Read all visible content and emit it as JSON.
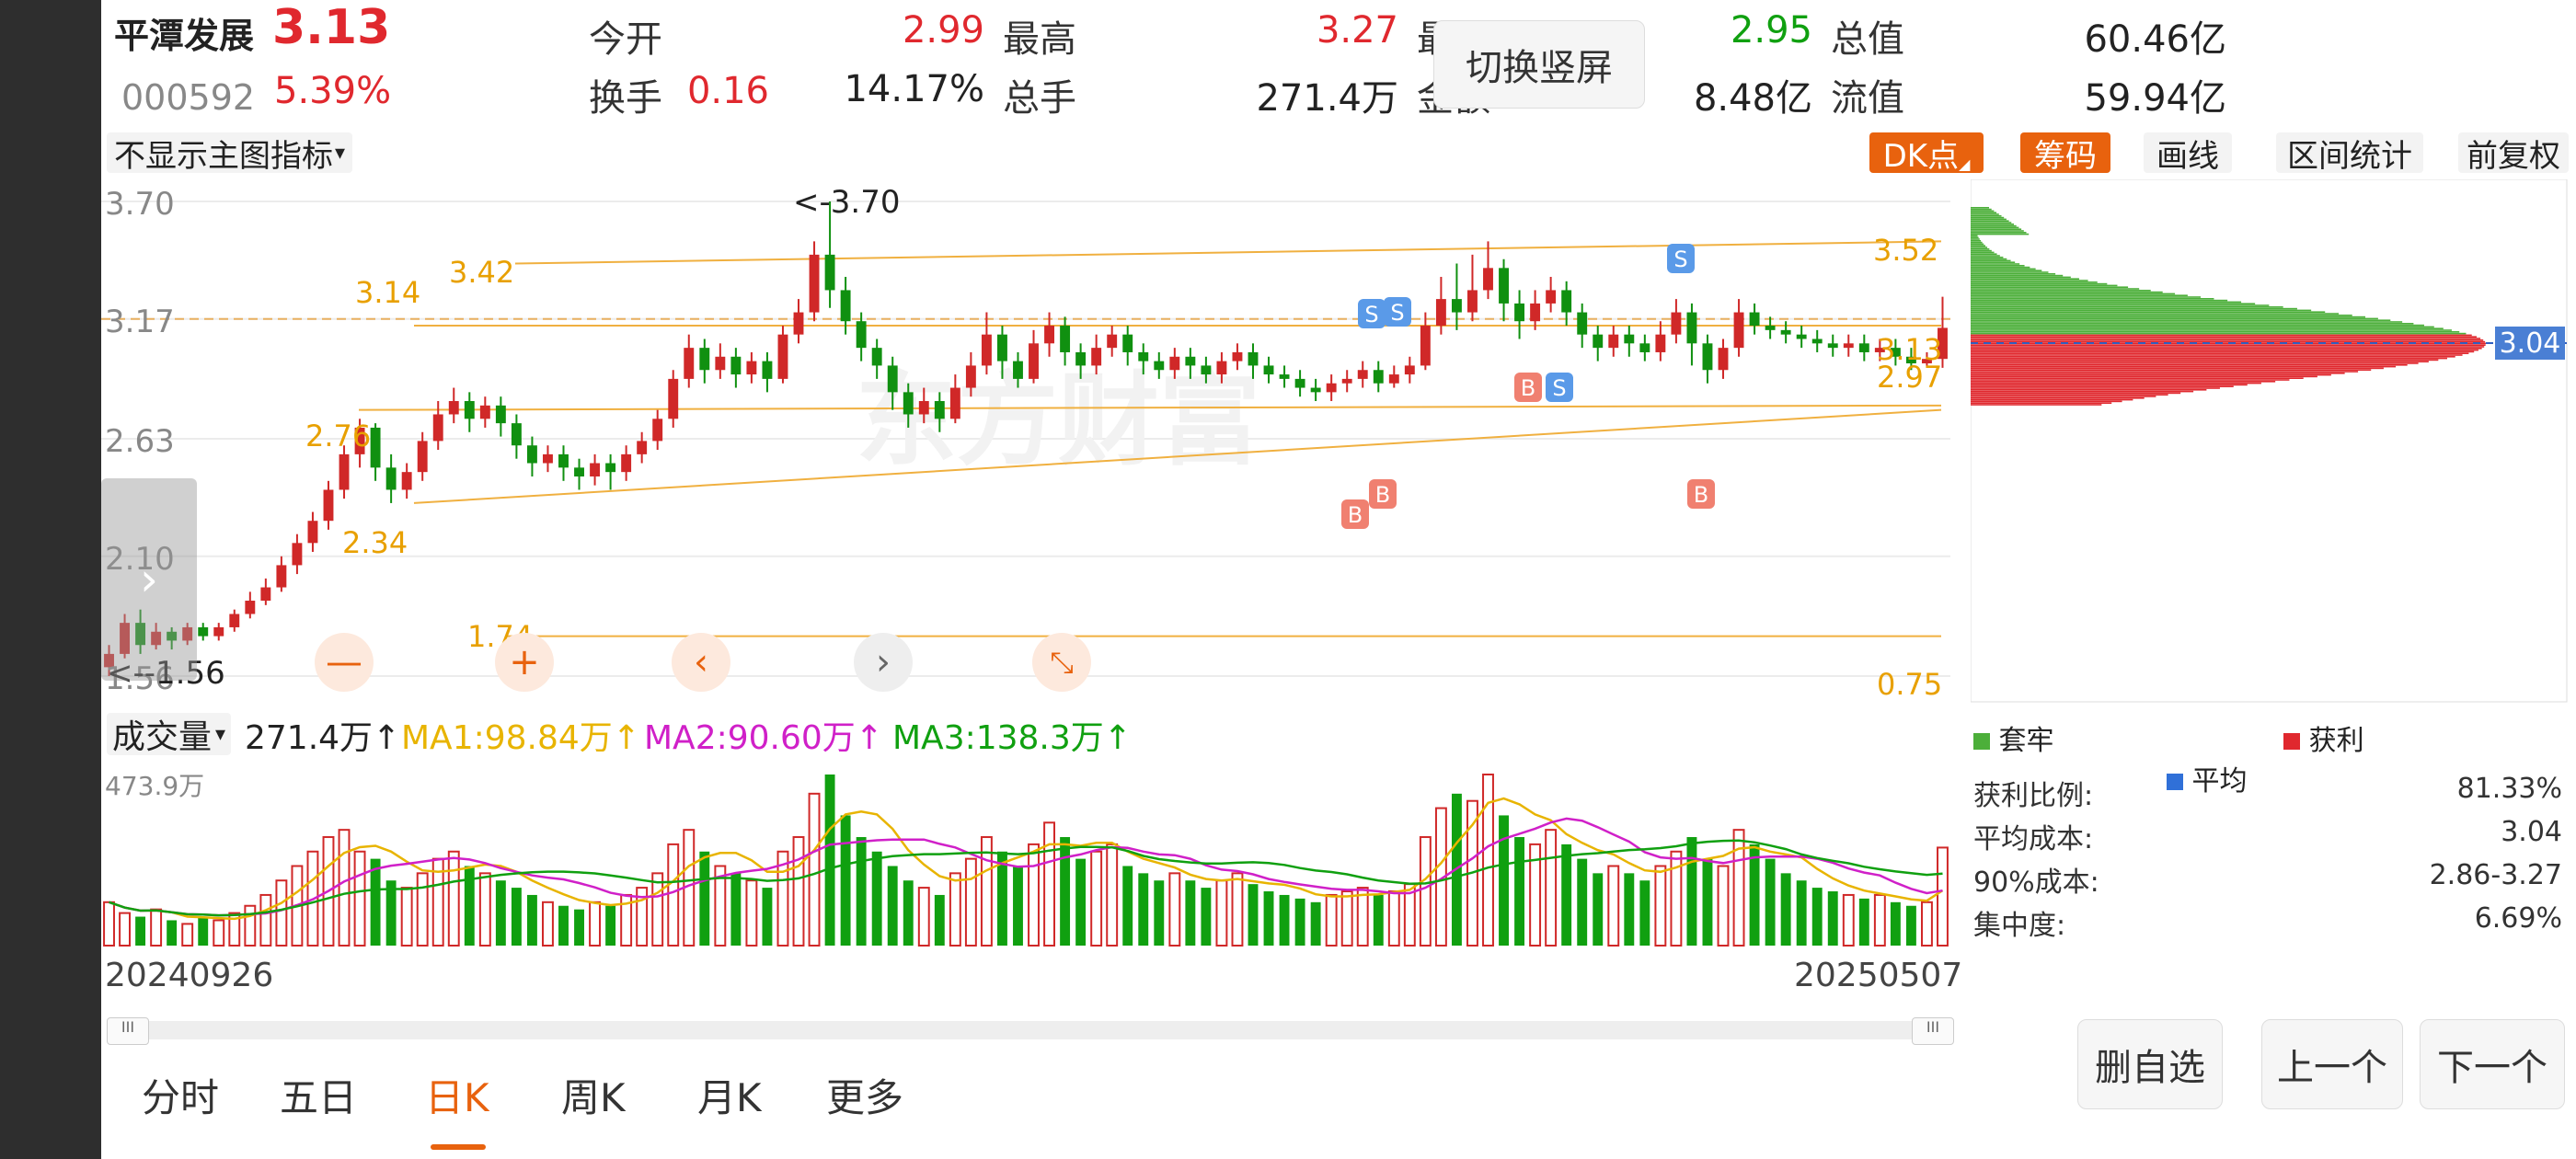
{
  "stock": {
    "name": "平潭发展",
    "price": "3.13",
    "code": "000592",
    "change_pct": "5.39%",
    "change": "0.16"
  },
  "quotes": [
    {
      "label": "今开",
      "value": "2.99",
      "color": "red"
    },
    {
      "label": "最高",
      "value": "3.27",
      "color": "red"
    },
    {
      "label": "最低",
      "value": "2.95",
      "color": "green"
    },
    {
      "label": "总值",
      "value": "60.46亿",
      "color": "black"
    },
    {
      "label": "换手",
      "value": "14.17%",
      "color": "black"
    },
    {
      "label": "总手",
      "value": "271.4万",
      "color": "black"
    },
    {
      "label": "金额",
      "value": "8.48亿",
      "color": "black"
    },
    {
      "label": "流值",
      "value": "59.94亿",
      "color": "black"
    }
  ],
  "switch_button": "切换竖屏",
  "toolbar": {
    "indicator_select": "不显示主图指标",
    "dk": "DK点",
    "chips": "筹码",
    "draw": "画线",
    "interval": "区间统计",
    "adjust": "前复权"
  },
  "price_axis": [
    "3.70",
    "3.17",
    "2.63",
    "2.10",
    "1.56"
  ],
  "price_annotations": {
    "high_marker": "<-3.70",
    "low_marker": "<--1.56",
    "level_342": "3.42",
    "level_314": "3.14",
    "level_352": "3.52",
    "level_276": "2.76",
    "level_234": "2.34",
    "level_174": "1.74",
    "level_313": "3.13",
    "level_297": "2.97",
    "level_075": "0.75"
  },
  "chip_price": "3.04",
  "chip_legend": {
    "trapped": "套牢",
    "profit": "获利",
    "average": "平均"
  },
  "chip_stats": [
    {
      "label": "获利比例:",
      "value": "81.33%"
    },
    {
      "label": "平均成本:",
      "value": "3.04"
    },
    {
      "label": "90%成本:",
      "value": "2.86-3.27"
    },
    {
      "label": "集中度:",
      "value": "6.69%"
    }
  ],
  "volume": {
    "selector": "成交量",
    "current": "271.4万↑",
    "ma1": "MA1:98.84万↑",
    "ma2": "MA2:90.60万↑",
    "ma3": "MA3:138.3万↑",
    "axis_top": "473.9万"
  },
  "dates": {
    "start": "20240926",
    "end": "20250507"
  },
  "watermark": "东方财富",
  "period_tabs": [
    "分时",
    "五日",
    "日K",
    "周K",
    "月K",
    "更多"
  ],
  "active_tab": "日K",
  "bottom_buttons": {
    "delete": "删自选",
    "prev": "上一个",
    "next": "下一个"
  },
  "colors": {
    "up": "#e0282e",
    "down": "#10a010",
    "accent": "#e8620e",
    "ma1": "#e8b400",
    "ma2": "#d020c8",
    "ma3": "#10a010"
  },
  "chart_data": {
    "type": "candlestick",
    "ylim": [
      1.56,
      3.7
    ],
    "candles": [
      [
        1.6,
        1.66,
        1.56,
        1.7
      ],
      [
        1.66,
        1.8,
        1.64,
        1.84
      ],
      [
        1.8,
        1.7,
        1.66,
        1.86
      ],
      [
        1.7,
        1.76,
        1.68,
        1.8
      ],
      [
        1.76,
        1.72,
        1.68,
        1.78
      ],
      [
        1.72,
        1.78,
        1.7,
        1.8
      ],
      [
        1.78,
        1.74,
        1.72,
        1.8
      ],
      [
        1.74,
        1.78,
        1.72,
        1.8
      ],
      [
        1.78,
        1.84,
        1.76,
        1.86
      ],
      [
        1.84,
        1.9,
        1.82,
        1.94
      ],
      [
        1.9,
        1.96,
        1.88,
        2.0
      ],
      [
        1.96,
        2.06,
        1.94,
        2.1
      ],
      [
        2.06,
        2.16,
        2.02,
        2.2
      ],
      [
        2.16,
        2.26,
        2.12,
        2.3
      ],
      [
        2.26,
        2.4,
        2.22,
        2.44
      ],
      [
        2.4,
        2.56,
        2.36,
        2.6
      ],
      [
        2.56,
        2.68,
        2.5,
        2.72
      ],
      [
        2.68,
        2.5,
        2.44,
        2.7
      ],
      [
        2.5,
        2.4,
        2.34,
        2.56
      ],
      [
        2.4,
        2.48,
        2.36,
        2.52
      ],
      [
        2.48,
        2.62,
        2.44,
        2.66
      ],
      [
        2.62,
        2.74,
        2.58,
        2.8
      ],
      [
        2.74,
        2.8,
        2.7,
        2.86
      ],
      [
        2.8,
        2.72,
        2.66,
        2.84
      ],
      [
        2.72,
        2.78,
        2.68,
        2.82
      ],
      [
        2.78,
        2.7,
        2.64,
        2.82
      ],
      [
        2.7,
        2.6,
        2.54,
        2.74
      ],
      [
        2.6,
        2.52,
        2.46,
        2.64
      ],
      [
        2.52,
        2.56,
        2.48,
        2.6
      ],
      [
        2.56,
        2.5,
        2.44,
        2.6
      ],
      [
        2.5,
        2.46,
        2.4,
        2.54
      ],
      [
        2.46,
        2.52,
        2.42,
        2.56
      ],
      [
        2.52,
        2.48,
        2.4,
        2.56
      ],
      [
        2.48,
        2.56,
        2.44,
        2.6
      ],
      [
        2.56,
        2.62,
        2.52,
        2.66
      ],
      [
        2.62,
        2.72,
        2.58,
        2.76
      ],
      [
        2.72,
        2.9,
        2.68,
        2.94
      ],
      [
        2.9,
        3.04,
        2.86,
        3.1
      ],
      [
        3.04,
        2.94,
        2.88,
        3.08
      ],
      [
        2.94,
        3.0,
        2.9,
        3.06
      ],
      [
        3.0,
        2.92,
        2.86,
        3.04
      ],
      [
        2.92,
        2.98,
        2.88,
        3.02
      ],
      [
        2.98,
        2.9,
        2.84,
        3.02
      ],
      [
        2.9,
        3.1,
        2.88,
        3.14
      ],
      [
        3.1,
        3.2,
        3.06,
        3.26
      ],
      [
        3.2,
        3.46,
        3.16,
        3.52
      ],
      [
        3.46,
        3.3,
        3.22,
        3.7
      ],
      [
        3.3,
        3.16,
        3.1,
        3.36
      ],
      [
        3.16,
        3.04,
        2.98,
        3.2
      ],
      [
        3.04,
        2.96,
        2.9,
        3.08
      ],
      [
        2.96,
        2.84,
        2.76,
        3.0
      ],
      [
        2.84,
        2.74,
        2.68,
        2.88
      ],
      [
        2.74,
        2.8,
        2.7,
        2.86
      ],
      [
        2.8,
        2.72,
        2.66,
        2.84
      ],
      [
        2.72,
        2.86,
        2.7,
        2.92
      ],
      [
        2.86,
        2.96,
        2.82,
        3.02
      ],
      [
        2.96,
        3.1,
        2.92,
        3.2
      ],
      [
        3.1,
        2.98,
        2.9,
        3.14
      ],
      [
        2.98,
        2.9,
        2.86,
        3.02
      ],
      [
        2.9,
        3.06,
        2.88,
        3.12
      ],
      [
        3.06,
        3.14,
        3.0,
        3.2
      ],
      [
        3.14,
        3.02,
        2.96,
        3.18
      ],
      [
        3.02,
        2.96,
        2.9,
        3.06
      ],
      [
        2.96,
        3.04,
        2.92,
        3.1
      ],
      [
        3.04,
        3.1,
        3.0,
        3.14
      ],
      [
        3.1,
        3.02,
        2.96,
        3.14
      ],
      [
        3.02,
        2.98,
        2.92,
        3.06
      ],
      [
        2.98,
        2.94,
        2.9,
        3.02
      ],
      [
        2.94,
        3.0,
        2.9,
        3.04
      ],
      [
        3.0,
        2.96,
        2.9,
        3.04
      ],
      [
        2.96,
        2.92,
        2.88,
        3.0
      ],
      [
        2.92,
        2.98,
        2.88,
        3.02
      ],
      [
        2.98,
        3.02,
        2.94,
        3.06
      ],
      [
        3.02,
        2.96,
        2.9,
        3.06
      ],
      [
        2.96,
        2.92,
        2.88,
        3.0
      ],
      [
        2.92,
        2.9,
        2.86,
        2.96
      ],
      [
        2.9,
        2.86,
        2.82,
        2.94
      ],
      [
        2.86,
        2.84,
        2.8,
        2.9
      ],
      [
        2.84,
        2.88,
        2.8,
        2.92
      ],
      [
        2.88,
        2.9,
        2.84,
        2.94
      ],
      [
        2.9,
        2.94,
        2.86,
        2.98
      ],
      [
        2.94,
        2.88,
        2.84,
        2.98
      ],
      [
        2.88,
        2.92,
        2.86,
        2.96
      ],
      [
        2.92,
        2.96,
        2.88,
        3.0
      ],
      [
        2.96,
        3.14,
        2.94,
        3.2
      ],
      [
        3.14,
        3.26,
        3.1,
        3.36
      ],
      [
        3.26,
        3.2,
        3.12,
        3.42
      ],
      [
        3.2,
        3.3,
        3.16,
        3.46
      ],
      [
        3.3,
        3.4,
        3.26,
        3.52
      ],
      [
        3.4,
        3.24,
        3.16,
        3.44
      ],
      [
        3.24,
        3.16,
        3.08,
        3.3
      ],
      [
        3.16,
        3.24,
        3.12,
        3.3
      ],
      [
        3.24,
        3.3,
        3.2,
        3.36
      ],
      [
        3.3,
        3.2,
        3.14,
        3.34
      ],
      [
        3.2,
        3.1,
        3.04,
        3.24
      ],
      [
        3.1,
        3.04,
        2.98,
        3.14
      ],
      [
        3.04,
        3.1,
        3.0,
        3.14
      ],
      [
        3.1,
        3.06,
        3.0,
        3.14
      ],
      [
        3.06,
        3.02,
        2.98,
        3.1
      ],
      [
        3.02,
        3.1,
        2.98,
        3.16
      ],
      [
        3.1,
        3.2,
        3.06,
        3.26
      ],
      [
        3.2,
        3.06,
        2.96,
        3.24
      ],
      [
        3.06,
        2.94,
        2.88,
        3.1
      ],
      [
        2.94,
        3.04,
        2.9,
        3.08
      ],
      [
        3.04,
        3.2,
        3.0,
        3.26
      ],
      [
        3.2,
        3.14,
        3.1,
        3.24
      ],
      [
        3.14,
        3.12,
        3.08,
        3.18
      ],
      [
        3.12,
        3.1,
        3.06,
        3.16
      ],
      [
        3.1,
        3.08,
        3.04,
        3.14
      ],
      [
        3.08,
        3.06,
        3.02,
        3.12
      ],
      [
        3.06,
        3.04,
        3.0,
        3.1
      ],
      [
        3.04,
        3.06,
        3.0,
        3.1
      ],
      [
        3.06,
        3.02,
        2.98,
        3.1
      ],
      [
        3.02,
        3.04,
        2.98,
        3.08
      ],
      [
        3.04,
        3.0,
        2.96,
        3.08
      ],
      [
        3.0,
        2.97,
        2.94,
        3.04
      ],
      [
        2.97,
        2.99,
        2.95,
        3.02
      ],
      [
        2.99,
        3.13,
        2.95,
        3.27
      ]
    ],
    "volume": [
      120,
      90,
      80,
      100,
      70,
      60,
      80,
      70,
      90,
      110,
      140,
      180,
      220,
      260,
      300,
      320,
      260,
      240,
      180,
      160,
      200,
      240,
      260,
      220,
      200,
      180,
      160,
      140,
      120,
      110,
      100,
      120,
      110,
      140,
      160,
      200,
      280,
      320,
      260,
      220,
      200,
      180,
      160,
      260,
      300,
      420,
      473,
      360,
      300,
      260,
      220,
      180,
      160,
      140,
      200,
      240,
      300,
      260,
      220,
      280,
      340,
      300,
      240,
      260,
      280,
      220,
      200,
      180,
      200,
      180,
      160,
      180,
      200,
      170,
      150,
      140,
      130,
      120,
      140,
      150,
      160,
      140,
      150,
      170,
      300,
      380,
      420,
      400,
      473,
      360,
      300,
      280,
      320,
      280,
      240,
      200,
      220,
      200,
      180,
      220,
      260,
      300,
      240,
      220,
      320,
      280,
      240,
      200,
      180,
      160,
      150,
      140,
      130,
      140,
      120,
      110,
      120,
      271
    ]
  }
}
